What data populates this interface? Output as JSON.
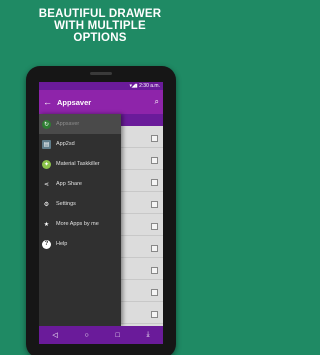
{
  "promo": {
    "line1": "BEAUTIFUL DRAWER",
    "line2": "WITH MULTIPLE",
    "line3": "OPTIONS"
  },
  "status_bar": {
    "time": "2:30 a.m."
  },
  "app_bar": {
    "title": "Appsaver"
  },
  "drawer": {
    "items": [
      {
        "label": "Appsaver",
        "icon": "refresh-icon",
        "color": "#2e7d32"
      },
      {
        "label": "App2sd",
        "icon": "sd-card-icon",
        "color": "#607d8b"
      },
      {
        "label": "Material Taskkiller",
        "icon": "android-icon",
        "color": "#8bc34a"
      },
      {
        "label": "App Share",
        "icon": "share-icon",
        "color": "#ffffff"
      },
      {
        "label": "Settings",
        "icon": "gear-icon",
        "color": "#ffffff"
      },
      {
        "label": "More Apps by me",
        "icon": "star-icon",
        "color": "#ffffff"
      },
      {
        "label": "Help",
        "icon": "help-icon",
        "color": "#ffffff"
      }
    ]
  },
  "colors": {
    "background": "#1f8a64",
    "primary": "#8e24aa",
    "primary_dark": "#6a1b9a",
    "drawer": "#303030"
  }
}
